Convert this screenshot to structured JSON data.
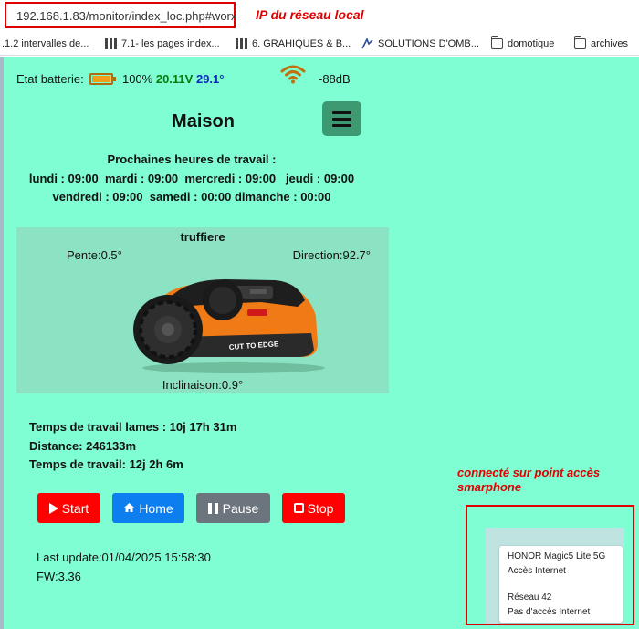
{
  "browser": {
    "url": "192.168.1.83/monitor/index_loc.php#worx",
    "annotation_ip": "IP du réseau local",
    "bookmarks": [
      {
        "label": ".1.2 intervalles de...",
        "icon": "none"
      },
      {
        "label": "7.1- les pages index...",
        "icon": "grid-icon"
      },
      {
        "label": "6. GRAHIQUES & B...",
        "icon": "grid-icon"
      },
      {
        "label": "SOLUTIONS D'OMB...",
        "icon": "app-icon"
      },
      {
        "label": "domotique",
        "icon": "folder-icon"
      },
      {
        "label": "archives",
        "icon": "folder-icon"
      }
    ]
  },
  "status": {
    "battery_label": "Etat batterie:",
    "battery_percent": "100%",
    "voltage": "20.11V",
    "temperature": "29.1°",
    "signal": "-88dB",
    "colors": {
      "voltage": "#0a7a0a",
      "temperature": "#0a2ab8",
      "wifi": "#c07010"
    }
  },
  "header": {
    "title": "Maison"
  },
  "schedule": {
    "heading": "Prochaines heures de travail :",
    "line1": "lundi : 09:00  mardi : 09:00  mercredi : 09:00   jeudi : 09:00",
    "line2": "vendredi : 09:00  samedi : 00:00 dimanche : 00:00"
  },
  "mower": {
    "zone": "truffiere",
    "slope": "Pente:0.5°",
    "direction": "Direction:92.7°",
    "inclination": "Inclinaison:0.9°",
    "body_text": "CUT TO EDGE"
  },
  "stats": {
    "blade_time": "Temps de travail lames : 10j 17h 31m",
    "distance": "Distance: 246133m",
    "work_time": "Temps de travail: 12j 2h 6m"
  },
  "actions": {
    "start": "Start",
    "home": "Home",
    "pause": "Pause",
    "stop": "Stop"
  },
  "footer": {
    "last_update": "Last update:01/04/2025 15:58:30",
    "firmware": "FW:3.36"
  },
  "annotation_hotspot": {
    "line1": "connecté sur point accès",
    "line2": "smarphone"
  },
  "wifi_list": [
    {
      "name": "HONOR Magic5 Lite 5G",
      "status": "Accès Internet"
    },
    {
      "name": "Réseau 42",
      "status": "Pas d'accès Internet"
    }
  ]
}
